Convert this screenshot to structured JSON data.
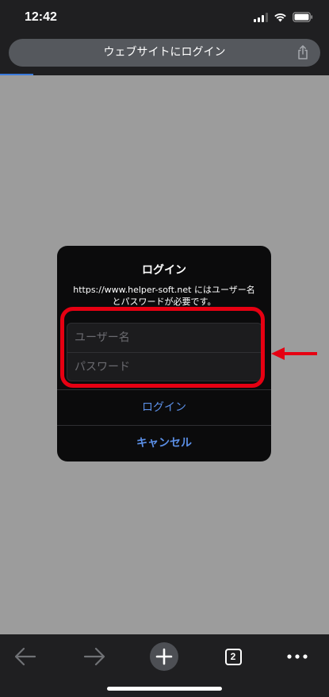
{
  "status_bar": {
    "time": "12:42"
  },
  "browser": {
    "page_title": "ウェブサイトにログイン",
    "open_tab_count": "2",
    "accent_color": "#3b7bdc"
  },
  "dialog": {
    "title": "ログイン",
    "message": "https://www.helper-soft.net にはユーザー名とパスワードが必要です。",
    "username_placeholder": "ユーザー名",
    "password_placeholder": "パスワード",
    "login_button": "ログイン",
    "cancel_button": "キャンセル",
    "button_color": "#5b8fe6"
  },
  "annotation": {
    "highlight_color": "#e60012"
  },
  "icons": {
    "back": "arrow-left-icon",
    "forward": "arrow-right-icon",
    "new_tab": "plus-icon",
    "tabs": "tab-switcher-icon",
    "menu": "more-dots-icon",
    "share": "share-icon",
    "wifi": "wifi-icon",
    "battery": "battery-icon",
    "signal": "signal-icon"
  }
}
